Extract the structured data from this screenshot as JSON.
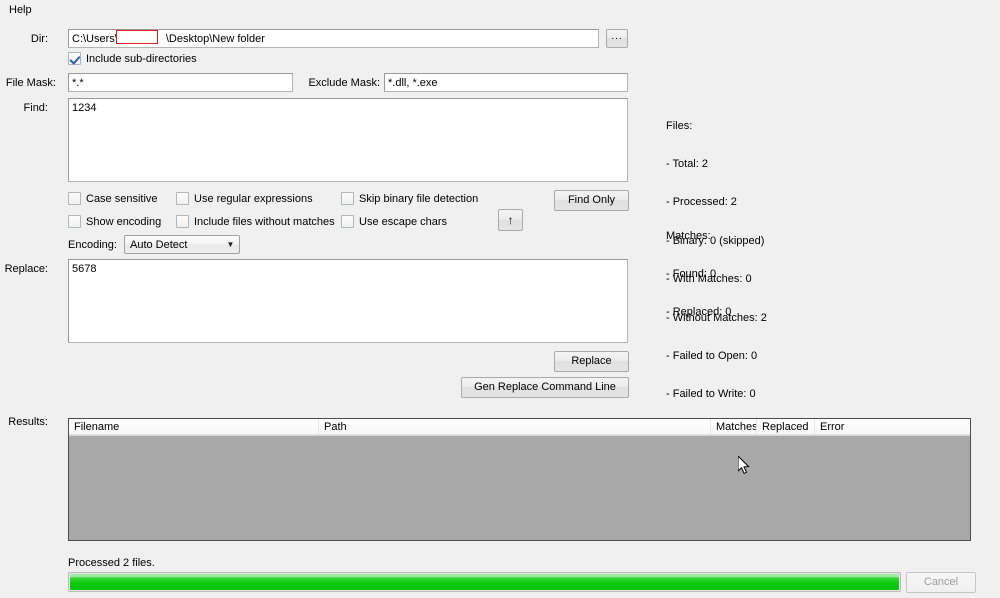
{
  "menubar": {
    "help_label": "Help"
  },
  "dir": {
    "label": "Dir:",
    "value": "C:\\Users\\            \\Desktop\\New folder",
    "value_prefix": "C:\\Users\\",
    "value_suffix": "\\Desktop\\New folder",
    "browse_label": "...",
    "include_subdirs_label": "Include sub-directories",
    "include_subdirs_checked": true
  },
  "masks": {
    "file_mask_label": "File Mask:",
    "file_mask_value": "*.*",
    "exclude_mask_label": "Exclude Mask:",
    "exclude_mask_value": "*.dll, *.exe"
  },
  "find": {
    "label": "Find:",
    "value": "1234"
  },
  "options": {
    "case_sensitive": {
      "label": "Case sensitive",
      "checked": false
    },
    "use_regex": {
      "label": "Use regular expressions",
      "checked": false
    },
    "skip_binary": {
      "label": "Skip binary file detection",
      "checked": false
    },
    "show_encoding": {
      "label": "Show encoding",
      "checked": false
    },
    "include_without_matches": {
      "label": "Include files without matches",
      "checked": false
    },
    "use_escape_chars": {
      "label": "Use escape chars",
      "checked": false
    }
  },
  "encoding": {
    "label": "Encoding:",
    "value": "Auto Detect",
    "arrow": "▼"
  },
  "buttons": {
    "find_only": "Find Only",
    "swap_arrow": "↑",
    "replace": "Replace",
    "gen_replace_command_line": "Gen Replace Command Line",
    "cancel": "Cancel",
    "cancel_disabled": true
  },
  "replace": {
    "label": "Replace:",
    "value": "5678"
  },
  "stats": {
    "files_heading": "Files:",
    "files_lines": [
      "- Total: 2",
      "- Processed: 2",
      "- Binary: 0 (skipped)",
      "- With Matches: 0",
      "- Without Matches: 2",
      "- Failed to Open: 0",
      "- Failed to Write: 0"
    ],
    "matches_heading": "Matches:",
    "matches_lines": [
      "- Found: 0",
      "- Replaced: 0"
    ]
  },
  "results": {
    "label": "Results:",
    "columns": [
      "Filename",
      "Path",
      "Matches",
      "Replaced",
      "Error"
    ],
    "rows": []
  },
  "status": {
    "text": "Processed 2 files.",
    "progress_percent": 100
  },
  "colors": {
    "window_bg": "#f0f0f0",
    "progress_green": "#10cc10",
    "redaction_border": "#e02020",
    "results_body": "#a8a8a8",
    "checkbox_check": "#2b5fa8"
  }
}
